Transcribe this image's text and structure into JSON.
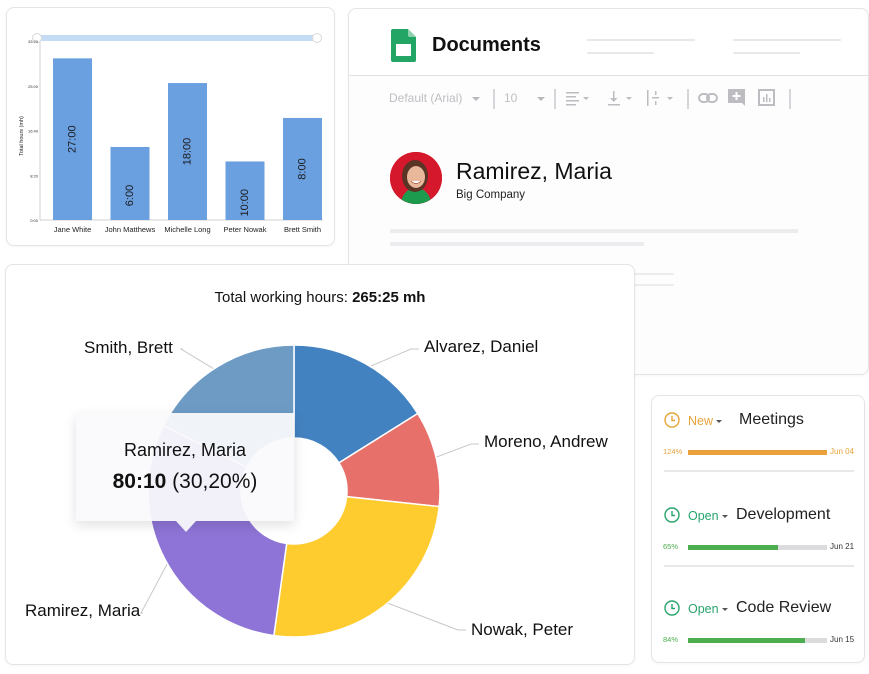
{
  "bar_panel": {
    "chart_data": {
      "type": "bar",
      "title": "",
      "xlabel": "",
      "ylabel": "Total hours (mh)",
      "categories": [
        "Jane White",
        "John Matthews",
        "Michelle Long",
        "Peter Nowak",
        "Brett Smith"
      ],
      "values": [
        30.1,
        13.6,
        25.5,
        10.9,
        19.0
      ],
      "data_labels": [
        "27:00",
        "6:00",
        "18:00",
        "10:00",
        "8:00"
      ],
      "yticks": [
        "0:00",
        "8:20",
        "16:40",
        "25:00",
        "33:20"
      ],
      "ylim": [
        0,
        33.33
      ],
      "grid": false,
      "bar_color": "#6a9fe0",
      "range_slider": true
    }
  },
  "documents": {
    "title": "Documents",
    "toolbar": {
      "font": "Default (Arial)",
      "size": "10"
    },
    "person": {
      "name": "Ramirez, Maria",
      "company": "Big Company"
    },
    "accent": "#23a566"
  },
  "pie_panel": {
    "title_prefix": "Total working hours:",
    "title_value": "265:25 mh",
    "tooltip": {
      "name": "Ramirez, Maria",
      "value": "80:10",
      "percent": "(30,20%)"
    },
    "chart_data": {
      "type": "pie",
      "donut": true,
      "title": "Total working hours: 265:25 mh",
      "slices": [
        {
          "label": "Alvarez, Daniel",
          "percent": 16.1,
          "color": "#4382c0"
        },
        {
          "label": "Moreno, Andrew",
          "percent": 10.6,
          "color": "#e7716a"
        },
        {
          "label": "Nowak, Peter",
          "percent": 25.5,
          "color": "#fecc2f"
        },
        {
          "label": "Ramirez, Maria",
          "percent": 30.2,
          "color": "#8d74d6"
        },
        {
          "label": "Smith, Brett",
          "percent": 17.6,
          "color": "#6d9bc4"
        }
      ]
    }
  },
  "tasks": [
    {
      "status": "New",
      "status_color": "#e6a43a",
      "name": "Meetings",
      "progress_label": "124%",
      "progress": 1.24,
      "bar_color": "#e9a13a",
      "due": "Jun 04",
      "due_color": "#e6a43a"
    },
    {
      "status": "Open",
      "status_color": "#27a46c",
      "name": "Development",
      "progress_label": "65%",
      "progress": 0.65,
      "bar_color": "#4cae4f",
      "due": "Jun 21",
      "due_color": "#333333"
    },
    {
      "status": "Open",
      "status_color": "#27a46c",
      "name": "Code Review",
      "progress_label": "84%",
      "progress": 0.84,
      "bar_color": "#4cae4f",
      "due": "Jun 15",
      "due_color": "#333333"
    }
  ]
}
